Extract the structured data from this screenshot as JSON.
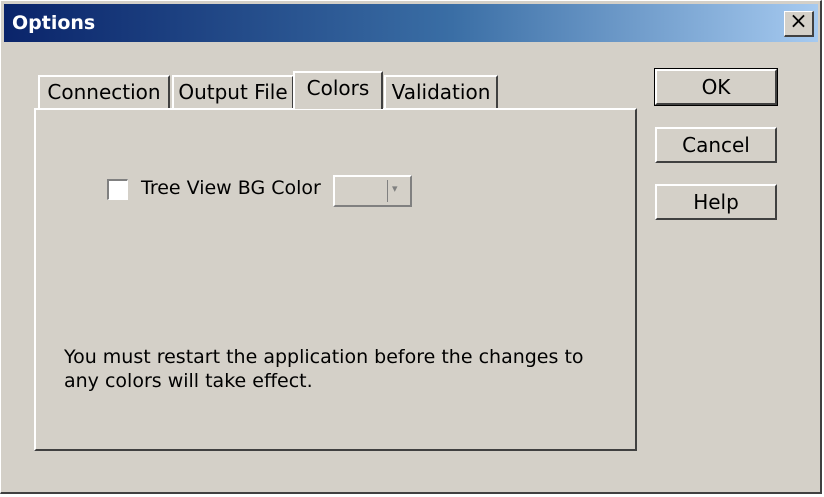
{
  "window": {
    "title": "Options",
    "close_label": "×"
  },
  "tabs": [
    {
      "label": "Connection"
    },
    {
      "label": "Output File"
    },
    {
      "label": "Colors",
      "active": true
    },
    {
      "label": "Validation"
    }
  ],
  "colors_tab": {
    "checkbox_label": "Tree View BG Color",
    "checkbox_checked": false,
    "dropdown_arrow": "▾",
    "note": "You must restart the application before the changes to any colors will take effect."
  },
  "buttons": {
    "ok": "OK",
    "cancel": "Cancel",
    "help": "Help"
  },
  "colors": {
    "face": "#d4d0c8",
    "title_start": "#0a246a",
    "title_end": "#a6caf0"
  }
}
